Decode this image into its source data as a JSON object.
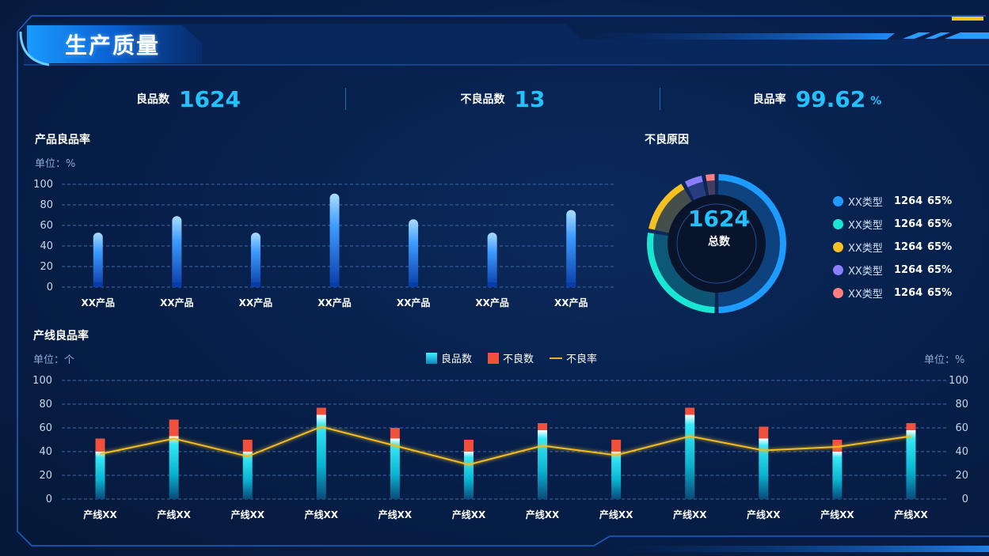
{
  "header": {
    "title": "生产质量"
  },
  "kpis": [
    {
      "label": "良品数",
      "value": "1624",
      "unit": ""
    },
    {
      "label": "不良品数",
      "value": "13",
      "unit": ""
    },
    {
      "label": "良品率",
      "value": "99.62",
      "unit": "%"
    }
  ],
  "product_rate": {
    "title": "产品良品率",
    "unit": "单位：%"
  },
  "defect": {
    "title": "不良原因",
    "total": "1624",
    "total_label": "总数",
    "legend": [
      {
        "name": "XX类型",
        "count": "1264",
        "pct": "65%",
        "color": "#1e9bff"
      },
      {
        "name": "XX类型",
        "count": "1264",
        "pct": "65%",
        "color": "#19e6d3"
      },
      {
        "name": "XX类型",
        "count": "1264",
        "pct": "65%",
        "color": "#f5c022"
      },
      {
        "name": "XX类型",
        "count": "1264",
        "pct": "65%",
        "color": "#8a7dff"
      },
      {
        "name": "XX类型",
        "count": "1264",
        "pct": "65%",
        "color": "#ff7f7f"
      }
    ]
  },
  "line_rate": {
    "title": "产线良品率",
    "unit_left": "单位：个",
    "unit_right": "单位：%",
    "legend": [
      {
        "label": "良品数",
        "color": "#19c7e6"
      },
      {
        "label": "不良数",
        "color": "#f0503c"
      },
      {
        "label": "不良率",
        "color": "#e8b21c"
      }
    ]
  },
  "chart_data": [
    {
      "type": "bar",
      "title": "产品良品率",
      "ylabel": "单位：%",
      "categories": [
        "XX产品",
        "XX产品",
        "XX产品",
        "XX产品",
        "XX产品",
        "XX产品",
        "XX产品"
      ],
      "values": [
        53,
        69,
        53,
        91,
        66,
        53,
        75
      ],
      "ylim": [
        0,
        100
      ],
      "yticks": [
        0,
        20,
        40,
        60,
        80,
        100
      ],
      "grid": true
    },
    {
      "type": "pie",
      "title": "不良原因",
      "labels": [
        "XX类型",
        "XX类型",
        "XX类型",
        "XX类型",
        "XX类型"
      ],
      "values": [
        50,
        28,
        14,
        5,
        3
      ]
    },
    {
      "type": "bar",
      "title": "产线良品率",
      "stacked": true,
      "categories": [
        "产线XX",
        "产线XX",
        "产线XX",
        "产线XX",
        "产线XX",
        "产线XX",
        "产线XX",
        "产线XX",
        "产线XX",
        "产线XX",
        "产线XX",
        "产线XX"
      ],
      "series": [
        {
          "name": "良品数",
          "type": "bar",
          "values": [
            40,
            53,
            40,
            71,
            51,
            40,
            58,
            40,
            71,
            51,
            40,
            58
          ]
        },
        {
          "name": "不良数",
          "type": "bar",
          "values": [
            11,
            14,
            10,
            6,
            9,
            10,
            6,
            10,
            6,
            10,
            10,
            6
          ]
        },
        {
          "name": "不良率",
          "type": "line",
          "axis": "right",
          "values": [
            38,
            51,
            36,
            61,
            45,
            29,
            45,
            37,
            53,
            41,
            44,
            53
          ]
        }
      ],
      "ylabel": "单位：个",
      "y2label": "单位：%",
      "ylim": [
        0,
        100
      ],
      "y2lim": [
        0,
        100
      ],
      "yticks": [
        0,
        20,
        40,
        60,
        80,
        100
      ],
      "legend_position": "top-center",
      "grid": true
    }
  ]
}
